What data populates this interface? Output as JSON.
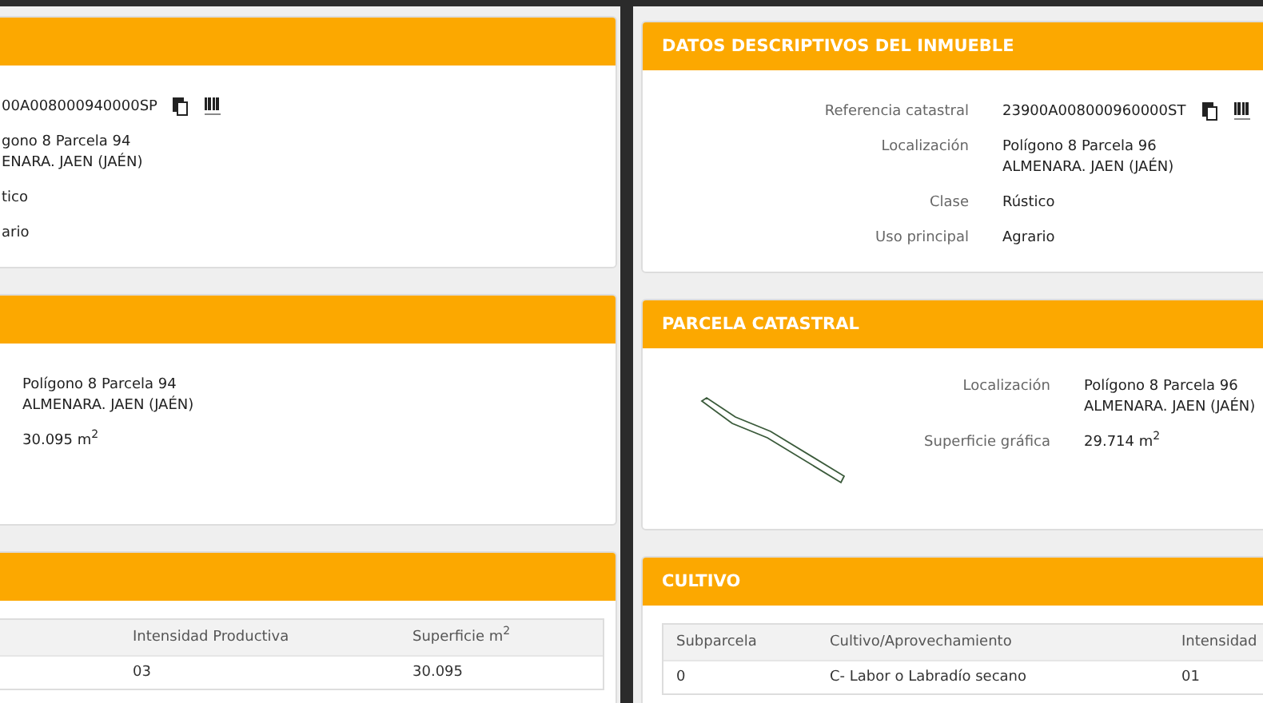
{
  "windows": [
    {
      "kind": "cut",
      "panels": [
        {
          "kind": "fields",
          "rows": [
            {
              "kind": "reference",
              "lines": [
                "00A008000940000SP"
              ]
            },
            {
              "kind": "text",
              "lines": [
                "gono 8 Parcela 94",
                "ENARA. JAEN (JAÉN)"
              ]
            },
            {
              "kind": "text",
              "lines": [
                "tico"
              ]
            },
            {
              "kind": "text",
              "lines": [
                "ario"
              ]
            }
          ]
        },
        {
          "kind": "parcel",
          "rows": [
            {
              "kind": "text",
              "lines": [
                "Polígono 8 Parcela 94",
                "ALMENARA. JAEN (JAÉN)"
              ]
            },
            {
              "kind": "text",
              "lines": [
                "30.095 m$^{2}$"
              ]
            }
          ]
        },
        {
          "kind": "table",
          "columns": [
            "Intensidad Productiva",
            "Superficie m$^{2}$"
          ],
          "rows": [
            [
              "03",
              "30.095"
            ]
          ]
        }
      ]
    },
    {
      "kind": "full",
      "panels": [
        {
          "kind": "fields",
          "title": "DATOS DESCRIPTIVOS DEL INMUEBLE",
          "rows": [
            {
              "kind": "reference",
              "label": "Referencia catastral",
              "lines": [
                "23900A008000960000ST"
              ]
            },
            {
              "kind": "text",
              "label": "Localización",
              "lines": [
                "Polígono 8 Parcela 96",
                "ALMENARA. JAEN (JAÉN)"
              ]
            },
            {
              "kind": "text",
              "label": "Clase",
              "lines": [
                "Rústico"
              ]
            },
            {
              "kind": "text",
              "label": "Uso principal",
              "lines": [
                "Agrario"
              ]
            }
          ]
        },
        {
          "kind": "parcel",
          "title": "PARCELA CATASTRAL",
          "rows": [
            {
              "kind": "text",
              "label": "Localización",
              "lines": [
                "Polígono 8 Parcela 96",
                "ALMENARA. JAEN (JAÉN)"
              ]
            },
            {
              "kind": "text",
              "label": "Superficie gráfica",
              "lines": [
                "29.714 m$^{2}$"
              ]
            }
          ]
        },
        {
          "kind": "table",
          "title": "CULTIVO",
          "columns": [
            "Subparcela",
            "Cultivo/Aprovechamiento",
            "Intensidad"
          ],
          "rows": [
            [
              "0",
              "C- Labor o Labradío secano",
              "01"
            ]
          ]
        }
      ]
    }
  ]
}
